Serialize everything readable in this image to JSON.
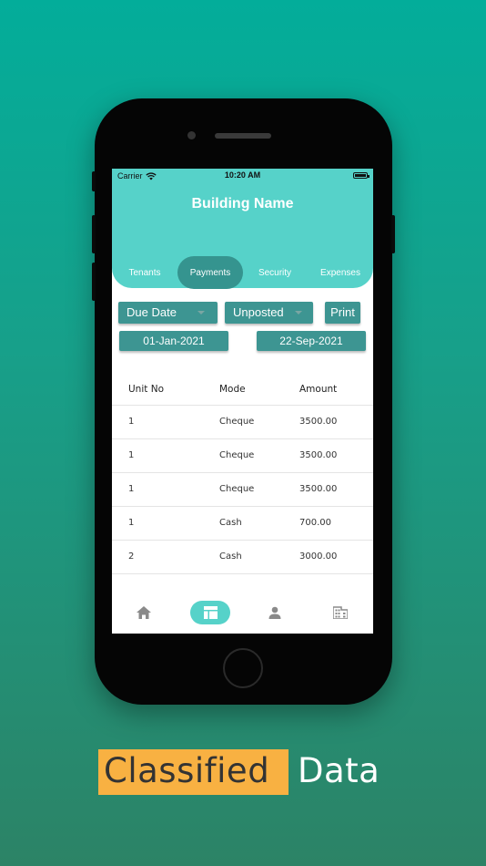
{
  "status_bar": {
    "carrier": "Carrier",
    "time": "10:20 AM"
  },
  "header": {
    "title": "Building Name"
  },
  "tabs": [
    {
      "label": "Tenants",
      "active": false
    },
    {
      "label": "Payments",
      "active": true
    },
    {
      "label": "Security",
      "active": false
    },
    {
      "label": "Expenses",
      "active": false
    }
  ],
  "filters": {
    "date_type": "Due Date",
    "status": "Unposted",
    "print_label": "Print",
    "from_date": "01-Jan-2021",
    "to_date": "22-Sep-2021"
  },
  "table": {
    "headers": [
      "Unit No",
      "Mode",
      "Amount"
    ],
    "rows": [
      [
        "1",
        "Cheque",
        "3500.00"
      ],
      [
        "1",
        "Cheque",
        "3500.00"
      ],
      [
        "1",
        "Cheque",
        "3500.00"
      ],
      [
        "1",
        "Cash",
        "700.00"
      ],
      [
        "2",
        "Cash",
        "3000.00"
      ]
    ]
  },
  "bottom_nav": [
    {
      "icon": "home-icon",
      "active": false
    },
    {
      "icon": "dashboard-icon",
      "active": true
    },
    {
      "icon": "person-icon",
      "active": false
    },
    {
      "icon": "building-icon",
      "active": false
    }
  ],
  "caption": {
    "highlight": "Classified",
    "rest": "Data"
  },
  "colors": {
    "background_top": "#03ad9a",
    "background_bottom": "#2c8366",
    "header": "#56d2c9",
    "active_tab": "#35948f",
    "control": "#3d9592",
    "highlight": "#f8b142"
  }
}
